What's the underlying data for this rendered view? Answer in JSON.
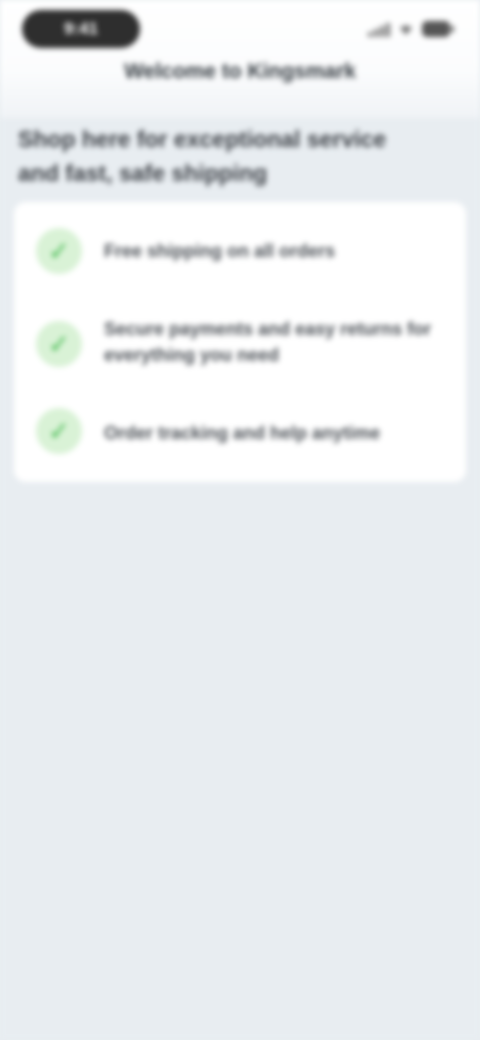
{
  "status_bar": {
    "time": "9:41"
  },
  "nav": {
    "title": "Welcome to Kingsmark"
  },
  "intro": {
    "text": "Shop here for exceptional service and fast, safe shipping"
  },
  "benefits": [
    {
      "label": "Free shipping on all orders",
      "icon": "check-icon"
    },
    {
      "label": "Secure payments and easy returns for everything you need",
      "icon": "check-icon"
    },
    {
      "label": "Order tracking and help anytime",
      "icon": "check-icon"
    }
  ],
  "colors": {
    "background": "#E8EDF1",
    "card": "#FFFFFF",
    "accent": "#3FB94B",
    "accent_tint": "#D9F2D6"
  }
}
